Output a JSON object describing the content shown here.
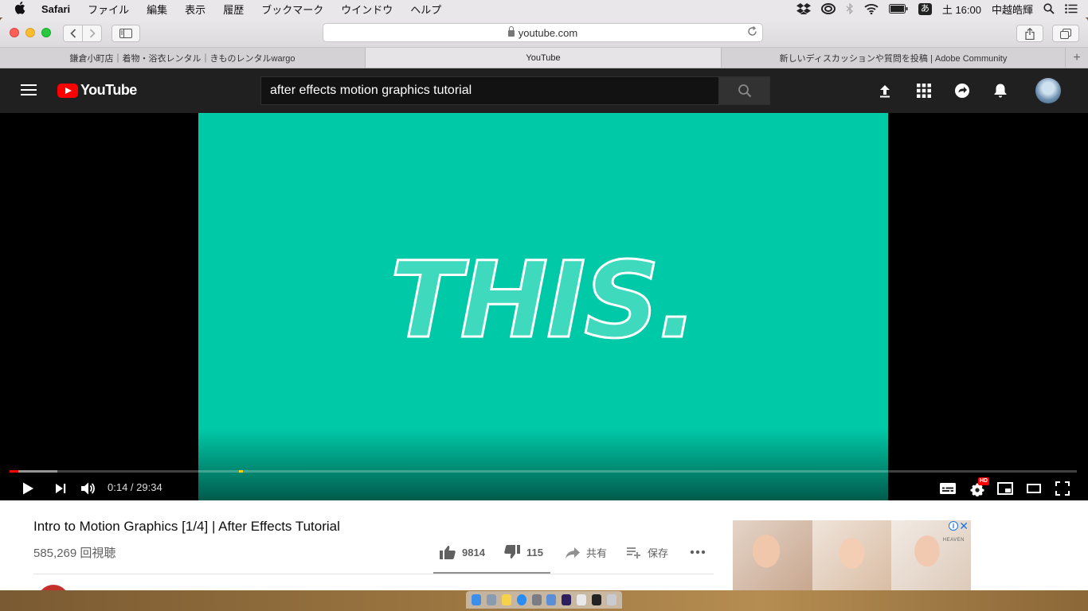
{
  "menubar": {
    "app": "Safari",
    "menus": [
      "ファイル",
      "編集",
      "表示",
      "履歴",
      "ブックマーク",
      "ウインドウ",
      "ヘルプ"
    ],
    "ime": "あ",
    "clock": "土 16:00",
    "user": "中越皓輝"
  },
  "browser": {
    "url": "youtube.com",
    "tabs": [
      {
        "label": "鎌倉小町店｜着物・浴衣レンタル｜きものレンタルwargo"
      },
      {
        "label": "YouTube"
      },
      {
        "label": "新しいディスカッションや質問を投稿 | Adobe Community"
      }
    ],
    "new_tab": "+"
  },
  "youtube": {
    "logo": "YouTube",
    "search_query": "after effects motion graphics tutorial",
    "player": {
      "frame_text": "THIS.",
      "time": "0:14 / 29:34",
      "progress_played": 0.008,
      "progress_loaded": 0.045,
      "hd_badge": "HD"
    },
    "video": {
      "title": "Intro to Motion Graphics [1/4] | After Effects Tutorial",
      "views": "585,269 回視聴",
      "likes": "9814",
      "dislikes": "115",
      "share": "共有",
      "save": "保存",
      "like_ratio": 0.988
    },
    "ad": {
      "info": "i",
      "close": "✕",
      "brand": "HEAVEN"
    }
  },
  "colors": {
    "video_bg": "#00c9a7",
    "yt_red": "#ff0000",
    "header_bg": "#202020"
  }
}
